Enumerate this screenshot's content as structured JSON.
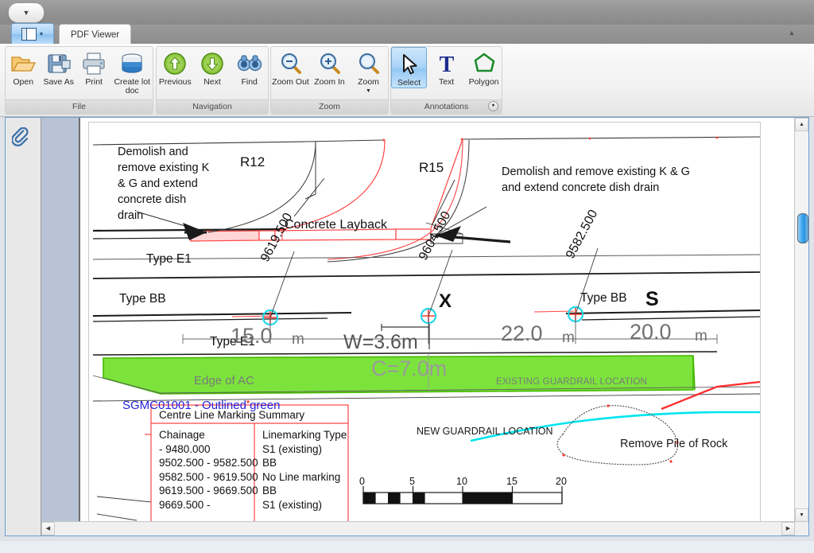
{
  "window": {
    "quick_access_icon": "chevron-down-icon",
    "app_button_icon": "layout-panes-icon",
    "collapse_ribbon_icon": "chevron-up-icon"
  },
  "tabs": [
    {
      "label": "PDF Viewer",
      "active": true
    }
  ],
  "ribbon": {
    "groups": [
      {
        "title": "File",
        "name": "file",
        "buttons": [
          {
            "label": "Open",
            "icon": "open-folder-icon"
          },
          {
            "label": "Save As",
            "icon": "save-as-icon"
          },
          {
            "label": "Print",
            "icon": "printer-icon"
          },
          {
            "label": "Create lot doc",
            "icon": "create-lot-doc-icon"
          }
        ]
      },
      {
        "title": "Navigation",
        "name": "navigation",
        "buttons": [
          {
            "label": "Previous",
            "icon": "arrow-up-circle-icon"
          },
          {
            "label": "Next",
            "icon": "arrow-down-circle-icon"
          },
          {
            "label": "Find",
            "icon": "binoculars-icon"
          }
        ]
      },
      {
        "title": "Zoom",
        "name": "zoom",
        "buttons": [
          {
            "label": "Zoom Out",
            "icon": "magnifier-minus-icon"
          },
          {
            "label": "Zoom In",
            "icon": "magnifier-plus-icon"
          },
          {
            "label": "Zoom",
            "icon": "magnifier-icon",
            "has_dropdown": true
          }
        ]
      },
      {
        "title": "Annotations",
        "name": "annotations",
        "dialog_launcher": true,
        "buttons": [
          {
            "label": "Select",
            "icon": "cursor-arrow-icon",
            "selected": true
          },
          {
            "label": "Text",
            "icon": "text-t-icon"
          },
          {
            "label": "Polygon",
            "icon": "polygon-icon"
          }
        ]
      }
    ]
  },
  "sidebar": {
    "attachments_icon": "paperclip-icon"
  },
  "scrollbars": {
    "vertical": {
      "up_icon": "triangle-up-icon",
      "down_icon": "triangle-down-icon"
    },
    "horizontal": {
      "left_icon": "triangle-left-icon",
      "right_icon": "triangle-right-icon"
    }
  },
  "drawing": {
    "annotations": [
      {
        "id": "note-left",
        "text": "Demolish and remove existing K & G and extend concrete dish drain"
      },
      {
        "id": "note-right",
        "text": "Demolish and remove existing K & G and extend concrete dish drain"
      },
      {
        "id": "radius-r12",
        "text": "R12"
      },
      {
        "id": "radius-r15",
        "text": "R15"
      },
      {
        "id": "concrete-layback",
        "text": "Concrete Layback"
      },
      {
        "id": "type-e1-upper",
        "text": "Type E1"
      },
      {
        "id": "type-e1-lower",
        "text": "Type E1"
      },
      {
        "id": "type-bb-left",
        "text": "Type BB"
      },
      {
        "id": "type-bb-right",
        "text": "Type BB"
      },
      {
        "id": "marker-x",
        "text": "X"
      },
      {
        "id": "marker-s",
        "text": "S"
      },
      {
        "id": "chainage-1",
        "text": "9619.500"
      },
      {
        "id": "chainage-2",
        "text": "9604.500"
      },
      {
        "id": "chainage-3",
        "text": "9582.500"
      },
      {
        "id": "dim-1",
        "text": "15.0"
      },
      {
        "id": "dim-1-unit",
        "text": "m"
      },
      {
        "id": "dim-2",
        "text": "22.0"
      },
      {
        "id": "dim-2-unit",
        "text": "m"
      },
      {
        "id": "dim-3",
        "text": "20.0"
      },
      {
        "id": "dim-3-unit",
        "text": "m"
      },
      {
        "id": "width-label",
        "text": "W=3.6m"
      },
      {
        "id": "carriageway-label",
        "text": "C=7.0m"
      },
      {
        "id": "edge-of-ac",
        "text": "Edge of AC"
      },
      {
        "id": "existing-guardrail",
        "text": "EXISTING GUARDRAIL LOCATION"
      },
      {
        "id": "new-guardrail",
        "text": "NEW GUARDRAIL LOCATION"
      },
      {
        "id": "lot-label",
        "text": "SGMC01001 - Outlined green"
      },
      {
        "id": "remove-pile",
        "text": "Remove Pile of Rock"
      }
    ],
    "table": {
      "caption": "Centre Line Marking Summary",
      "headers": [
        "Chainage",
        "Linemarking Type"
      ],
      "rows": [
        [
          " - 9480.000",
          "S1 (existing)"
        ],
        [
          "9502.500 - 9582.500",
          "BB"
        ],
        [
          "9582.500 - 9619.500",
          "No Line marking"
        ],
        [
          "9619.500 - 9669.500",
          "BB"
        ],
        [
          "9669.500 - ",
          "S1 (existing)"
        ]
      ]
    },
    "scale_bar": {
      "ticks": [
        "0",
        "5",
        "10",
        "15",
        "20"
      ]
    },
    "colors": {
      "green_fill": "#7CE33C",
      "green_stroke": "#44B900",
      "red": "#FF4444",
      "blue_text": "#2222DD",
      "cyan": "#00E5F0",
      "grey_text": "#7A7A7A"
    }
  }
}
